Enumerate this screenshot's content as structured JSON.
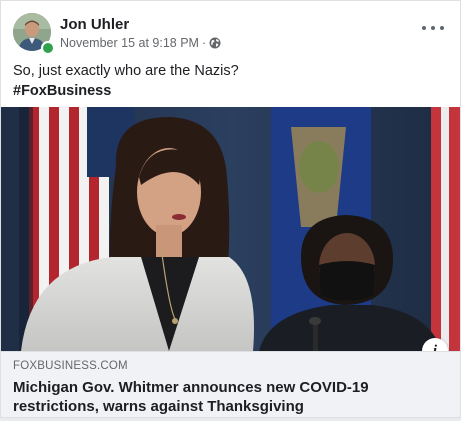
{
  "post": {
    "author_name": "Jon Uhler",
    "timestamp": "November 15 at 9:18 PM",
    "separator": "·",
    "privacy_icon": "globe-icon",
    "more_icon": "more-horizontal-icon",
    "text_line1": "So, just exactly who are the Nazis?",
    "hashtag": "#FoxBusiness"
  },
  "link_preview": {
    "domain": "FOXBUSINESS.COM",
    "title": "Michigan Gov. Whitmer announces new COVID-19 restrictions, warns against Thanksgiving",
    "info_label": "i",
    "info_icon": "info-icon"
  },
  "colors": {
    "online_status": "#31a24c",
    "footer_background": "#f0f2f5",
    "meta_text": "#65676b"
  }
}
